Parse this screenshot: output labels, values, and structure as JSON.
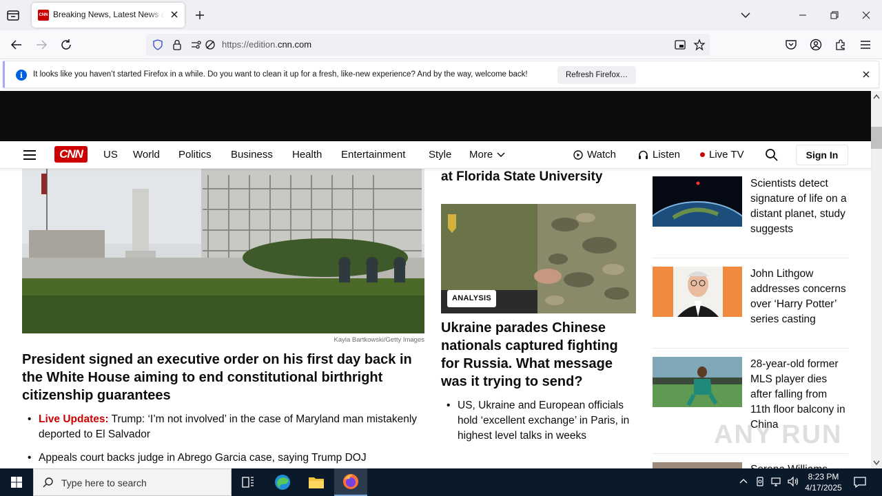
{
  "browser": {
    "tab": {
      "title": "Breaking News, Latest News and Videos | CNN",
      "favicon_text": "CNN"
    },
    "url_prefix": "https://edition.",
    "url_domain": "cnn.com",
    "notification": {
      "message": "It looks like you haven’t started Firefox in a while. Do you want to clean it up for a fresh, like-new experience? And by the way, welcome back!",
      "button": "Refresh Firefox…"
    }
  },
  "cnn_nav": {
    "logo": "CNN",
    "links": [
      "US",
      "World",
      "Politics",
      "Business",
      "Health",
      "Entertainment",
      "Style",
      "More"
    ],
    "watch": "Watch",
    "listen": "Listen",
    "live_tv": "Live TV",
    "sign_in": "Sign In"
  },
  "main": {
    "photo_credit": "Kayla Bartkowski/Getty Images",
    "headline": "President signed an executive order on his first day back in the White House aiming to end constitutional birthright citizenship guarantees",
    "bullets": [
      {
        "live_label": "Live Updates:",
        "text": " Trump: ‘I’m not involved’ in the case of Maryland man mistakenly deported to El Salvador"
      },
      {
        "live_label": "",
        "text": "Appeals court backs judge in Abrego Garcia case, saying Trump DOJ"
      }
    ]
  },
  "middle": {
    "top_text": "at Florida State University",
    "badge": "ANALYSIS",
    "headline": "Ukraine parades Chinese nationals captured fighting for Russia. What message was it trying to send?",
    "bullet": "US, Ukraine and European officials hold ‘excellent exchange’ in Paris, in highest level talks in weeks"
  },
  "sidebar": [
    {
      "title": "Scientists detect signature of life on a distant planet, study suggests"
    },
    {
      "title": "John Lithgow addresses concerns over ‘Harry Potter’ series casting"
    },
    {
      "title": "28-year-old former MLS player dies after falling from 11th floor balcony in China"
    },
    {
      "title": "Serena Williams"
    }
  ],
  "watermark": "ANY RUN",
  "taskbar": {
    "search_placeholder": "Type here to search",
    "time": "8:23 PM",
    "date": "4/17/2025"
  }
}
